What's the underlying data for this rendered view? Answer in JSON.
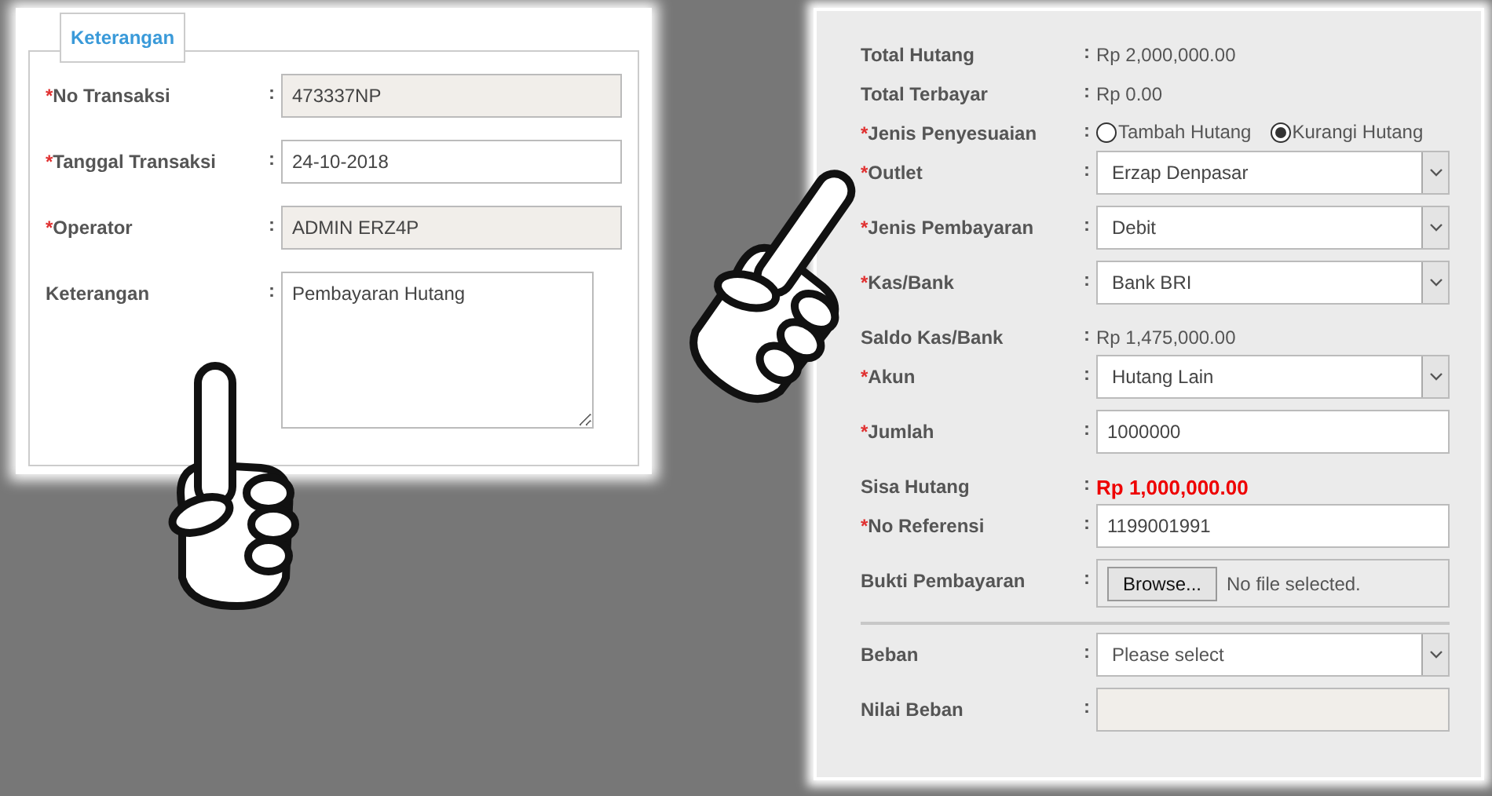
{
  "left_panel": {
    "legend": "Keterangan",
    "fields": [
      {
        "label": "No Transaksi",
        "required_mark": "*",
        "separator": ":",
        "kind": "text",
        "value": "473337NP",
        "readonly": true
      },
      {
        "label": "Tanggal Transaksi",
        "required_mark": "*",
        "separator": ":",
        "kind": "text",
        "value": "24-10-2018",
        "readonly": false
      },
      {
        "label": "Operator",
        "required_mark": "*",
        "separator": ":",
        "kind": "text",
        "value": "ADMIN ERZ4P",
        "readonly": true
      },
      {
        "label": "Keterangan",
        "separator": ":",
        "kind": "textarea",
        "value": "Pembayaran Hutang"
      }
    ]
  },
  "right_panel": {
    "fields": [
      {
        "label": "Total Hutang",
        "separator": ":",
        "kind": "display",
        "value": "Rp 2,000,000.00",
        "emphasis": false
      },
      {
        "label": "Total Terbayar",
        "separator": ":",
        "kind": "display",
        "value": "Rp 0.00",
        "emphasis": false
      },
      {
        "label": "Jenis Penyesuaian",
        "required_mark": "*",
        "separator": ":",
        "kind": "radio",
        "options": [
          {
            "label": "Tambah Hutang",
            "selected": false
          },
          {
            "label": "Kurangi Hutang",
            "selected": true
          }
        ]
      },
      {
        "label": "Outlet",
        "required_mark": "*",
        "separator": ":",
        "kind": "select",
        "value": "Erzap Denpasar"
      },
      {
        "label": "Jenis Pembayaran",
        "required_mark": "*",
        "separator": ":",
        "kind": "select",
        "value": "Debit"
      },
      {
        "label": "Kas/Bank",
        "required_mark": "*",
        "separator": ":",
        "kind": "select",
        "value": "Bank BRI"
      },
      {
        "label": "Saldo Kas/Bank",
        "separator": ":",
        "kind": "display",
        "value": "Rp 1,475,000.00",
        "emphasis": false
      },
      {
        "label": "Akun",
        "required_mark": "*",
        "separator": ":",
        "kind": "select",
        "value": "Hutang Lain"
      },
      {
        "label": "Jumlah",
        "required_mark": "*",
        "separator": ":",
        "kind": "text",
        "value": "1000000",
        "readonly": false
      },
      {
        "label": "Sisa Hutang",
        "separator": ":",
        "kind": "display",
        "value": "Rp 1,000,000.00",
        "emphasis": true
      },
      {
        "label": "No Referensi",
        "required_mark": "*",
        "separator": ":",
        "kind": "text",
        "value": "1199001991",
        "readonly": false
      },
      {
        "label": "Bukti Pembayaran",
        "separator": ":",
        "kind": "file",
        "button": "Browse...",
        "status": "No file selected."
      },
      {
        "label": "Beban",
        "separator": ":",
        "kind": "select",
        "placeholder": "Please select",
        "divider_before": true
      },
      {
        "label": "Nilai Beban",
        "separator": ":",
        "kind": "text",
        "readonly": true
      }
    ]
  }
}
